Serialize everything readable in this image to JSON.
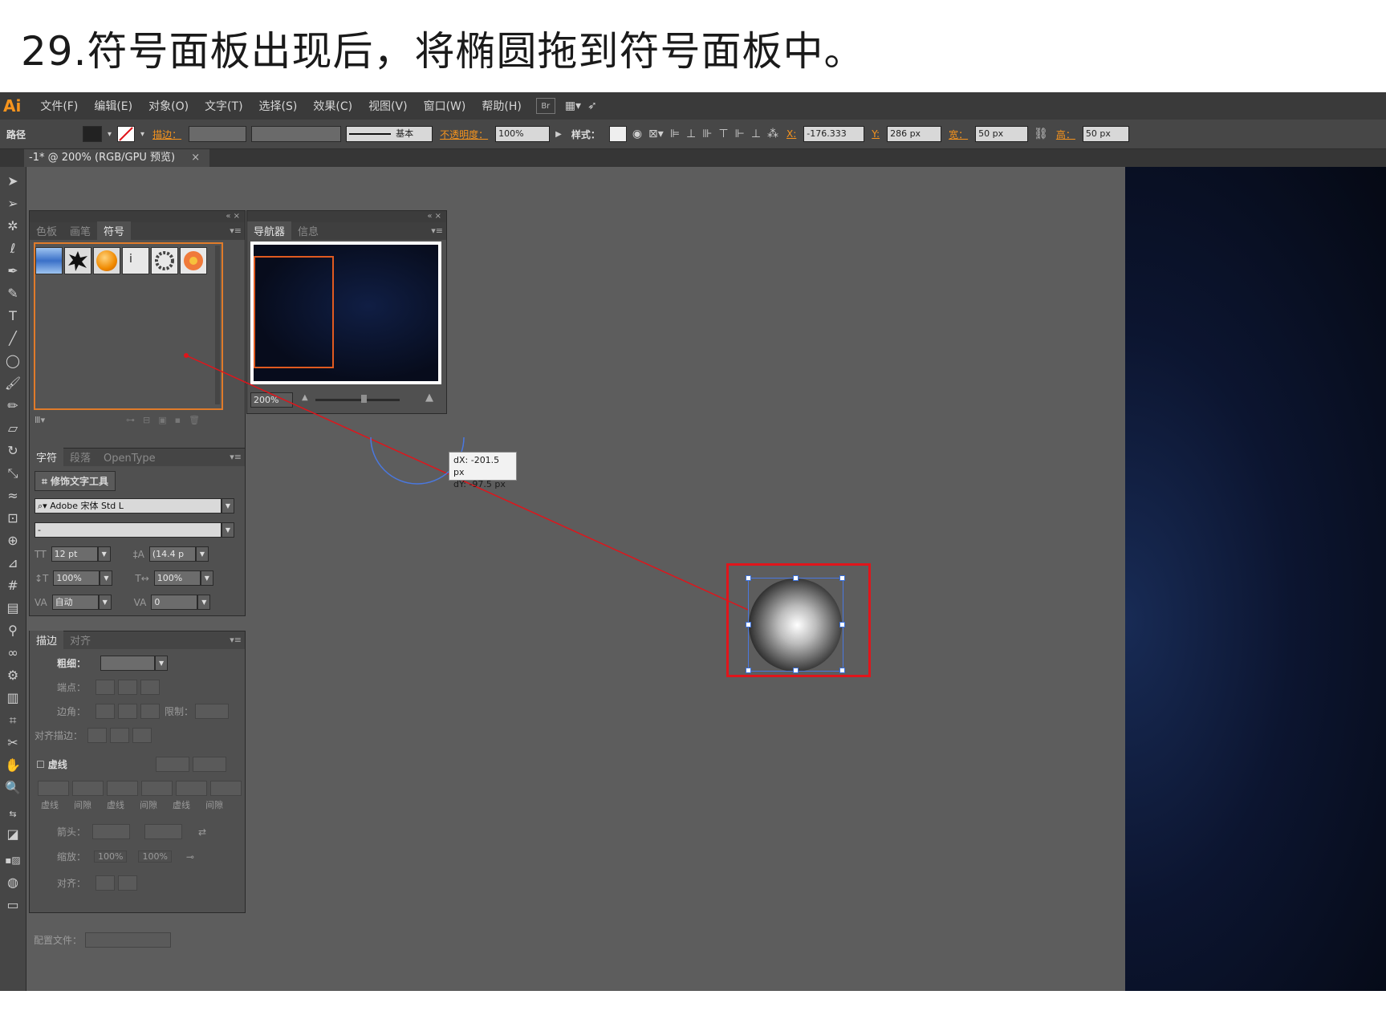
{
  "heading": "29.符号面板出现后，将椭圆拖到符号面板中。",
  "app": {
    "logo": "Ai",
    "menu": [
      "文件(F)",
      "编辑(E)",
      "对象(O)",
      "文字(T)",
      "选择(S)",
      "效果(C)",
      "视图(V)",
      "窗口(W)",
      "帮助(H)"
    ],
    "bridge_label": "Br"
  },
  "control_bar": {
    "path_label": "路径",
    "stroke_label": "描边：",
    "stroke_style": "基本",
    "opacity_label": "不透明度：",
    "opacity_value": "100%",
    "style_label": "样式：",
    "x_label": "X:",
    "x_value": "-176.333",
    "y_label": "Y:",
    "y_value": "286 px",
    "w_label": "宽：",
    "w_value": "50 px",
    "h_label": "高：",
    "h_value": "50 px"
  },
  "document_tab": {
    "title": "-1* @ 200% (RGB/GPU 预览)",
    "close": "×"
  },
  "symbols_panel": {
    "tabs": [
      "色板",
      "画笔",
      "符号"
    ],
    "active_tab": "符号",
    "symbol_names": [
      "blue-banner",
      "ink-splat",
      "orange-sphere",
      "marker",
      "wreath",
      "flower"
    ]
  },
  "navigator_panel": {
    "tabs": [
      "导航器",
      "信息"
    ],
    "active_tab": "导航器",
    "zoom_value": "200%"
  },
  "character_panel": {
    "tabs": [
      "字符",
      "段落",
      "OpenType"
    ],
    "touch_type_tool": "修饰文字工具",
    "font_family": "Adobe 宋体 Std L",
    "font_style": "-",
    "font_size": "12 pt",
    "leading": "(14.4 p",
    "vertical_scale": "100%",
    "horizontal_scale": "100%",
    "kerning": "自动",
    "tracking": "0"
  },
  "stroke_panel": {
    "tabs": [
      "描边",
      "对齐"
    ],
    "weight_label": "粗细：",
    "cap_label": "端点：",
    "corner_label": "边角：",
    "limit_label": "限制：",
    "align_label": "对齐描边：",
    "dashed_label": "虚线",
    "dash_labels": [
      "虚线",
      "间隙",
      "虚线",
      "间隙",
      "虚线",
      "间隙"
    ],
    "arrowheads_label": "箭头：",
    "scale_label": "缩放：",
    "scale_start": "100%",
    "scale_end": "100%",
    "align_label2": "对齐：",
    "profile_label": "配置文件："
  },
  "tooltip": {
    "dx": "dX: -201.5 px",
    "dy": "dY: -97.5 px"
  },
  "colors": {
    "accent_orange": "#f7941d",
    "highlight_red": "#e0151b",
    "selection_blue": "#4a78e0"
  }
}
